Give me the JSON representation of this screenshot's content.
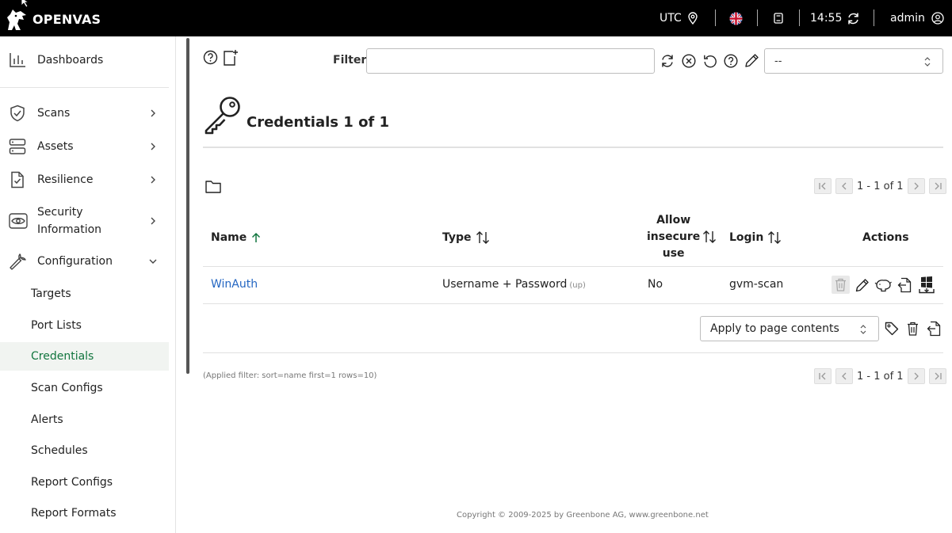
{
  "app": {
    "brand": "OPENVAS"
  },
  "topbar": {
    "timezone": "UTC",
    "time": "14:55",
    "user": "admin"
  },
  "sidebar": {
    "main": [
      {
        "label": "Dashboards",
        "icon": "chart-icon"
      },
      {
        "label": "Scans",
        "icon": "shield-check-icon"
      },
      {
        "label": "Assets",
        "icon": "server-icon"
      },
      {
        "label": "Resilience",
        "icon": "document-check-icon"
      },
      {
        "label": "Security Information",
        "icon": "eye-icon"
      },
      {
        "label": "Configuration",
        "icon": "wrench-icon"
      }
    ],
    "config_items": [
      {
        "label": "Targets"
      },
      {
        "label": "Port Lists"
      },
      {
        "label": "Credentials"
      },
      {
        "label": "Scan Configs"
      },
      {
        "label": "Alerts"
      },
      {
        "label": "Schedules"
      },
      {
        "label": "Report Configs"
      },
      {
        "label": "Report Formats"
      }
    ],
    "active": "Credentials"
  },
  "filter": {
    "label": "Filter",
    "value": "",
    "saved_filter": "--"
  },
  "page": {
    "title": "Credentials 1 of 1"
  },
  "pagination": {
    "text": "1 - 1 of 1"
  },
  "table": {
    "headers": {
      "name": "Name",
      "type": "Type",
      "allow_l1": "Allow",
      "allow_l2": "insecure",
      "allow_l3": "use",
      "login": "Login",
      "actions": "Actions"
    },
    "rows": [
      {
        "name": "WinAuth",
        "type": "Username + Password",
        "type_abbr": "(up)",
        "allow_insecure": "No",
        "login": "gvm-scan"
      }
    ]
  },
  "bulk": {
    "apply_to": "Apply to page contents"
  },
  "applied_filter": "(Applied filter: sort=name first=1 rows=10)",
  "footer": {
    "copyright": "Copyright © 2009-2025 by Greenbone AG, www.greenbone.net"
  },
  "colors": {
    "accent": "#11753e",
    "link": "#2466c2",
    "topbar": "#000000"
  }
}
